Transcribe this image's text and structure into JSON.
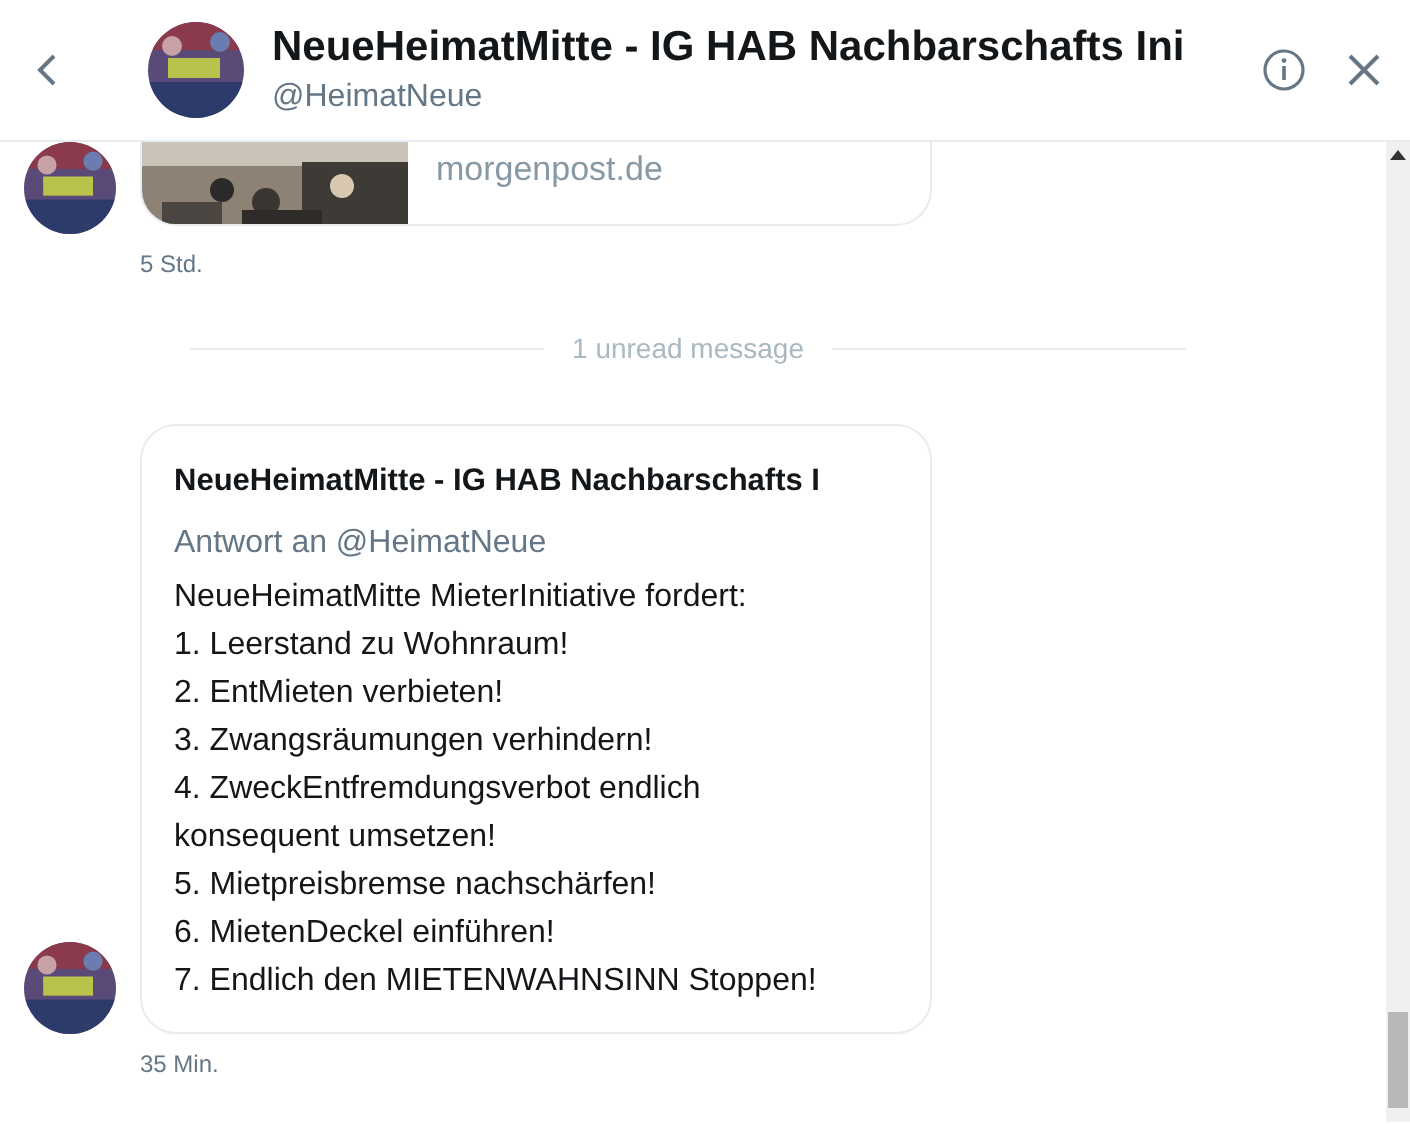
{
  "header": {
    "title": "NeueHeimatMitte - IG HAB Nachbarschafts Ini",
    "handle": "@HeimatNeue"
  },
  "messages": [
    {
      "kind": "link",
      "link_text": "morgenpost.de",
      "time": "5 Std."
    },
    {
      "kind": "divider",
      "text": "1 unread message"
    },
    {
      "kind": "tweet",
      "title": "NeueHeimatMitte - IG HAB Nachbarschafts I",
      "reply_to": "Antwort an @HeimatNeue",
      "lines": [
        "NeueHeimatMitte MieterInitiative fordert:",
        "1. Leerstand zu Wohnraum!",
        "2. EntMieten verbieten!",
        "3. Zwangsräumungen verhindern!",
        "4. ZweckEntfremdungsverbot endlich konsequent umsetzen!",
        "5. Mietpreisbremse nachschärfen!",
        "6. MietenDeckel einführen!",
        "7. Endlich den MIETENWAHNSINN Stoppen!"
      ],
      "time": "35 Min."
    }
  ]
}
